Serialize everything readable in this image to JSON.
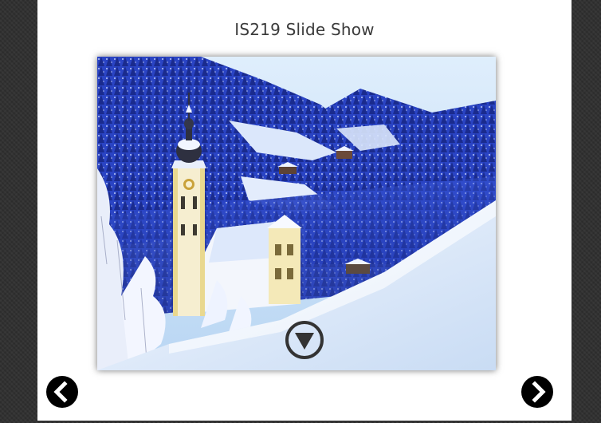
{
  "page": {
    "title": "IS219 Slide Show"
  },
  "slideshow": {
    "current_slide_alt": "Snowy alpine church in winter valley",
    "play_icon": "circle-down-triangle-icon",
    "prev_icon": "chevron-left-icon",
    "next_icon": "chevron-right-icon"
  },
  "colors": {
    "background": "#2f2f2f",
    "panel": "#ffffff",
    "title_text": "#3a3a3a",
    "button_fill": "#000000",
    "play_button": "#333333"
  }
}
